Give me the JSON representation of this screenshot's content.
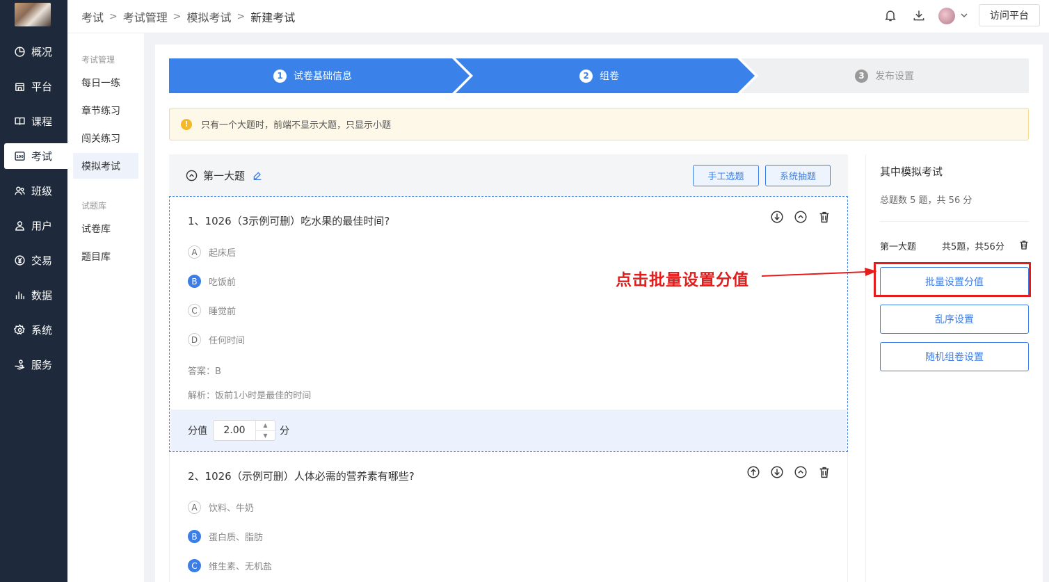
{
  "sidebar": {
    "items": [
      {
        "label": "概况",
        "icon": "pie-chart-icon"
      },
      {
        "label": "平台",
        "icon": "store-icon"
      },
      {
        "label": "课程",
        "icon": "book-icon"
      },
      {
        "label": "考试",
        "icon": "exam-100-icon",
        "active": true
      },
      {
        "label": "班级",
        "icon": "group-icon"
      },
      {
        "label": "用户",
        "icon": "user-icon"
      },
      {
        "label": "交易",
        "icon": "yen-circle-icon"
      },
      {
        "label": "数据",
        "icon": "bar-chart-icon"
      },
      {
        "label": "系统",
        "icon": "gear-icon"
      },
      {
        "label": "服务",
        "icon": "service-hand-icon"
      }
    ]
  },
  "subnav": {
    "group1": "考试管理",
    "items1": [
      "每日一练",
      "章节练习",
      "闯关练习",
      "模拟考试"
    ],
    "active": "模拟考试",
    "group2": "试题库",
    "items2": [
      "试卷库",
      "题目库"
    ]
  },
  "header": {
    "breadcrumb": [
      "考试",
      "考试管理",
      "模拟考试",
      "新建考试"
    ],
    "visit_label": "访问平台"
  },
  "steps": [
    {
      "num": "1",
      "label": "试卷基础信息",
      "state": "done"
    },
    {
      "num": "2",
      "label": "组卷",
      "state": "active"
    },
    {
      "num": "3",
      "label": "发布设置",
      "state": "pending"
    }
  ],
  "notice": "只有一个大题时，前端不显示大题，只显示小题",
  "section": {
    "title": "第一大题",
    "manual_label": "手工选题",
    "system_label": "系统抽题"
  },
  "questions": [
    {
      "title": "1、1026（3示例可删）吃水果的最佳时间?",
      "options": [
        {
          "letter": "A",
          "text": "起床后",
          "correct": false
        },
        {
          "letter": "B",
          "text": "吃饭前",
          "correct": true
        },
        {
          "letter": "C",
          "text": "睡觉前",
          "correct": false
        },
        {
          "letter": "D",
          "text": "任何时间",
          "correct": false
        }
      ],
      "answer": "答案：B",
      "analysis": "解析：饭前1小时是最佳的时间",
      "score_label": "分值",
      "score_value": "2.00",
      "score_unit": "分"
    },
    {
      "title": "2、1026（示例可删）人体必需的营养素有哪些?",
      "options": [
        {
          "letter": "A",
          "text": "饮料、牛奶",
          "correct": false
        },
        {
          "letter": "B",
          "text": "蛋白质、脂肪",
          "correct": true
        },
        {
          "letter": "C",
          "text": "维生素、无机盐",
          "correct": true
        }
      ]
    }
  ],
  "summary": {
    "title": "其中模拟考试",
    "total": "总题数 5 题，共 56 分",
    "section_name": "第一大题",
    "section_count": "共5题，共56分",
    "batch_label": "批量设置分值",
    "shuffle_label": "乱序设置",
    "random_label": "随机组卷设置"
  },
  "annotation": "点击批量设置分值",
  "colors": {
    "primary": "#3d7ee6",
    "sidebar_bg": "#1e2a3c",
    "annotation": "#e31c1c",
    "warning": "#f5b829"
  }
}
